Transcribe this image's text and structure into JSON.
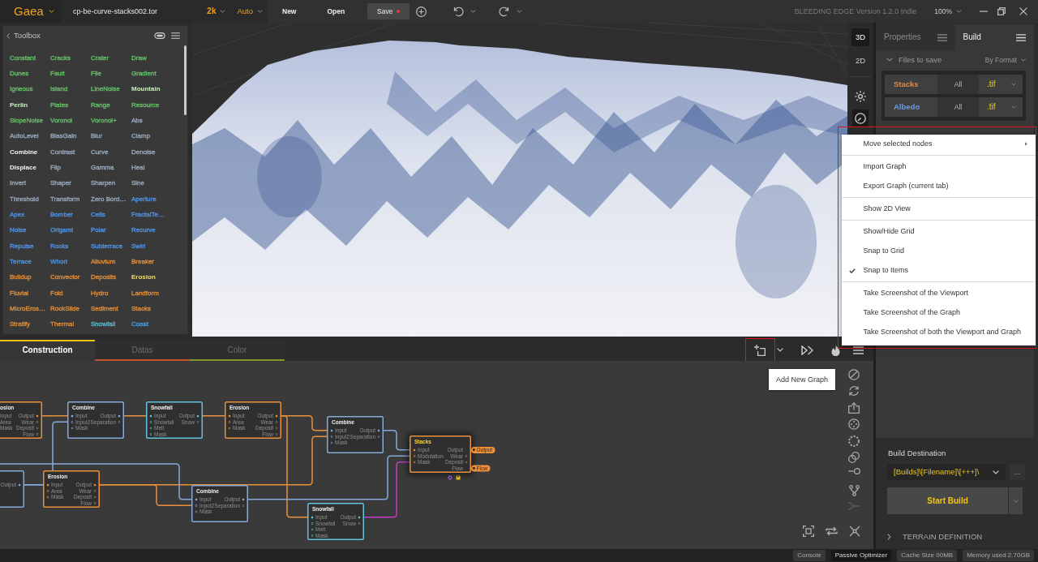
{
  "top_bar": {
    "app_name": "Gaea",
    "file_name": "cp-be-curve-stacks002.tor",
    "resolution": "2k",
    "mode": "Auto",
    "actions": [
      {
        "label": "New"
      },
      {
        "label": "Open"
      }
    ],
    "save": {
      "label": "Save",
      "unsaved": true
    },
    "version": "BLEEDING EDGE Version 1.2.0 Indie",
    "zoom": "100%"
  },
  "toolbox": {
    "title": "Toolbox",
    "items": [
      {
        "label": "Constant",
        "color": "#63b866",
        "highlighted": false
      },
      {
        "label": "Cracks",
        "color": "#63b866",
        "highlighted": false
      },
      {
        "label": "Crater",
        "color": "#63b866",
        "highlighted": false
      },
      {
        "label": "Draw",
        "color": "#63b866",
        "highlighted": false
      },
      {
        "label": "Dunes",
        "color": "#63b866",
        "highlighted": false
      },
      {
        "label": "Fault",
        "color": "#63b866",
        "highlighted": false
      },
      {
        "label": "File",
        "color": "#63b866",
        "highlighted": false
      },
      {
        "label": "Gradient",
        "color": "#63b866",
        "highlighted": false
      },
      {
        "label": "Igneous",
        "color": "#63b866",
        "highlighted": false
      },
      {
        "label": "Island",
        "color": "#63b866",
        "highlighted": false
      },
      {
        "label": "LineNoise",
        "color": "#63b866",
        "highlighted": false
      },
      {
        "label": "Mountain",
        "color": "#c9f0bd",
        "highlighted": true
      },
      {
        "label": "Perlin",
        "color": "#c9f0bd",
        "highlighted": true
      },
      {
        "label": "Plates",
        "color": "#63b866",
        "highlighted": false
      },
      {
        "label": "Range",
        "color": "#63b866",
        "highlighted": false
      },
      {
        "label": "Resource",
        "color": "#63b866",
        "highlighted": false
      },
      {
        "label": "SlopeNoise",
        "color": "#63b866",
        "highlighted": false
      },
      {
        "label": "Voronoi",
        "color": "#63b866",
        "highlighted": false
      },
      {
        "label": "Voronoi+",
        "color": "#63b866",
        "highlighted": false
      },
      {
        "label": "Abs",
        "color": "#93a4b6",
        "highlighted": false
      },
      {
        "label": "AutoLevel",
        "color": "#93a4b6",
        "highlighted": false
      },
      {
        "label": "BiasGain",
        "color": "#93a4b6",
        "highlighted": false
      },
      {
        "label": "Blur",
        "color": "#93a4b6",
        "highlighted": false
      },
      {
        "label": "Clamp",
        "color": "#93a4b6",
        "highlighted": false
      },
      {
        "label": "Combine",
        "color": "#f2f2f2",
        "highlighted": true
      },
      {
        "label": "Contrast",
        "color": "#93a4b6",
        "highlighted": false
      },
      {
        "label": "Curve",
        "color": "#93a4b6",
        "highlighted": false
      },
      {
        "label": "Denoise",
        "color": "#93a4b6",
        "highlighted": false
      },
      {
        "label": "Displace",
        "color": "#f2f2f2",
        "highlighted": true
      },
      {
        "label": "Flip",
        "color": "#93a4b6",
        "highlighted": false
      },
      {
        "label": "Gamma",
        "color": "#93a4b6",
        "highlighted": false
      },
      {
        "label": "Heal",
        "color": "#93a4b6",
        "highlighted": false
      },
      {
        "label": "Invert",
        "color": "#93a4b6",
        "highlighted": false
      },
      {
        "label": "Shaper",
        "color": "#93a4b6",
        "highlighted": false
      },
      {
        "label": "Sharpen",
        "color": "#93a4b6",
        "highlighted": false
      },
      {
        "label": "Sine",
        "color": "#93a4b6",
        "highlighted": false
      },
      {
        "label": "Threshold",
        "color": "#93a4b6",
        "highlighted": false
      },
      {
        "label": "Transform",
        "color": "#93a4b6",
        "highlighted": false
      },
      {
        "label": "Zero Bord…",
        "color": "#93a4b6",
        "highlighted": false
      },
      {
        "label": "Aperture",
        "color": "#4f8fdc",
        "highlighted": false
      },
      {
        "label": "Apex",
        "color": "#4f8fdc",
        "highlighted": false
      },
      {
        "label": "Bomber",
        "color": "#4f8fdc",
        "highlighted": false
      },
      {
        "label": "Cells",
        "color": "#4f8fdc",
        "highlighted": false
      },
      {
        "label": "FractalTe…",
        "color": "#4f8fdc",
        "highlighted": false
      },
      {
        "label": "Noise",
        "color": "#4f8fdc",
        "highlighted": false
      },
      {
        "label": "Origami",
        "color": "#4f8fdc",
        "highlighted": false
      },
      {
        "label": "Polar",
        "color": "#4f8fdc",
        "highlighted": false
      },
      {
        "label": "Recurve",
        "color": "#4f8fdc",
        "highlighted": false
      },
      {
        "label": "Repulse",
        "color": "#4f8fdc",
        "highlighted": false
      },
      {
        "label": "Rocks",
        "color": "#4f8fdc",
        "highlighted": false
      },
      {
        "label": "Subterrace",
        "color": "#4f8fdc",
        "highlighted": false
      },
      {
        "label": "Swirl",
        "color": "#4f8fdc",
        "highlighted": false
      },
      {
        "label": "Terrace",
        "color": "#4f8fdc",
        "highlighted": false
      },
      {
        "label": "Whorl",
        "color": "#4f8fdc",
        "highlighted": false
      },
      {
        "label": "Alluvium",
        "color": "#d88a3c",
        "highlighted": false
      },
      {
        "label": "Breaker",
        "color": "#d88a3c",
        "highlighted": false
      },
      {
        "label": "Buildup",
        "color": "#d88a3c",
        "highlighted": false
      },
      {
        "label": "Convector",
        "color": "#d88a3c",
        "highlighted": false
      },
      {
        "label": "Deposits",
        "color": "#d88a3c",
        "highlighted": false
      },
      {
        "label": "Erosion",
        "color": "#f3dd6a",
        "highlighted": true
      },
      {
        "label": "Fluvial",
        "color": "#d88a3c",
        "highlighted": false
      },
      {
        "label": "Fold",
        "color": "#d88a3c",
        "highlighted": false
      },
      {
        "label": "Hydro",
        "color": "#d88a3c",
        "highlighted": false
      },
      {
        "label": "Landform",
        "color": "#d88a3c",
        "highlighted": false
      },
      {
        "label": "MicroEros…",
        "color": "#d88a3c",
        "highlighted": false
      },
      {
        "label": "RockSlide",
        "color": "#d88a3c",
        "highlighted": false
      },
      {
        "label": "Sediment",
        "color": "#d88a3c",
        "highlighted": false
      },
      {
        "label": "Stacks",
        "color": "#d88a3c",
        "highlighted": false
      },
      {
        "label": "Stratify",
        "color": "#d88a3c",
        "highlighted": false
      },
      {
        "label": "Thermal",
        "color": "#d88a3c",
        "highlighted": false
      },
      {
        "label": "Snowfall",
        "color": "#55b7cb",
        "highlighted": false
      },
      {
        "label": "Coast",
        "color": "#3d9be0",
        "highlighted": false
      }
    ]
  },
  "viewport": {
    "views": [
      {
        "label": "3D",
        "selected": true
      },
      {
        "label": "2D",
        "selected": false
      }
    ],
    "tools": [
      {
        "active": false
      },
      {
        "active": true
      }
    ]
  },
  "graph": {
    "tabs": [
      {
        "label": "Construction",
        "selected": true,
        "color": "#f0c419"
      },
      {
        "label": "Datas",
        "selected": false,
        "color": "#c4532b"
      },
      {
        "label": "Color",
        "selected": false,
        "color": "#7f9a2a"
      }
    ],
    "new_graph_button": {
      "highlighted": true
    },
    "tooltip": "Add New Graph",
    "side_tools": [
      {
        "disabled": false
      },
      {
        "disabled": false
      },
      {
        "disabled": false
      },
      {
        "disabled": false
      },
      {
        "disabled": false
      },
      {
        "disabled": false
      },
      {
        "disabled": false
      },
      {
        "disabled": false
      },
      {
        "disabled": true
      }
    ],
    "nodes": [
      {
        "title": "osion",
        "color": "#e8913a",
        "selected": false,
        "inputs": [
          "Input",
          "Area",
          "Mask"
        ],
        "outputs": [
          {
            "label": "Output"
          },
          {
            "label": "Wear"
          },
          {
            "label": "Deposit"
          },
          {
            "label": "Flow"
          }
        ]
      },
      {
        "title": "Combine",
        "color": "#86a9dc",
        "selected": false,
        "inputs": [
          "Input",
          "Input2",
          "Mask"
        ],
        "outputs": [
          {
            "label": "Output"
          },
          {
            "label": "Separation"
          }
        ]
      },
      {
        "title": "Snowfall",
        "color": "#62c4dc",
        "selected": false,
        "inputs": [
          "Input",
          "Snowfall",
          "Melt",
          "Mask"
        ],
        "outputs": [
          {
            "label": "Output"
          },
          {
            "label": "Snow"
          }
        ]
      },
      {
        "title": "Erosion",
        "color": "#e8913a",
        "selected": false,
        "inputs": [
          "Input",
          "Area",
          "Mask"
        ],
        "outputs": [
          {
            "label": "Output"
          },
          {
            "label": "Wear"
          },
          {
            "label": "Deposit"
          },
          {
            "label": "Flow"
          }
        ]
      },
      {
        "title": "Combine",
        "color": "#86a9dc",
        "selected": false,
        "inputs": [
          "Input",
          "Input2",
          "Mask"
        ],
        "outputs": [
          {
            "label": "Output"
          },
          {
            "label": "Separation"
          }
        ]
      },
      {
        "title": "Stacks",
        "color": "#e8913a",
        "selected": true,
        "inputs": [
          "Input",
          "Modulation",
          "Mask"
        ],
        "outputs": [
          {
            "label": "Output",
            "tag": "Output"
          },
          {
            "label": "Wear"
          },
          {
            "label": "Deposit"
          },
          {
            "label": "Flow",
            "tag": "Flow"
          }
        ]
      },
      {
        "color": "#86a9dc",
        "selected": false,
        "outputs": [
          {
            "label": "Output"
          }
        ]
      },
      {
        "title": "Erosion",
        "color": "#e8913a",
        "selected": false,
        "inputs": [
          "Input",
          "Area",
          "Mask"
        ],
        "outputs": [
          {
            "label": "Output"
          },
          {
            "label": "Wear"
          },
          {
            "label": "Deposit"
          },
          {
            "label": "Flow"
          }
        ]
      },
      {
        "title": "Combine",
        "color": "#86a9dc",
        "selected": false,
        "inputs": [
          "Input",
          "Input2",
          "Mask"
        ],
        "outputs": [
          {
            "label": "Output"
          },
          {
            "label": "Separation"
          }
        ]
      },
      {
        "title": "Snowfall",
        "color": "#62c4dc",
        "selected": false,
        "inputs": [
          "Input",
          "Snowfall",
          "Melt",
          "Mask"
        ],
        "outputs": [
          {
            "label": "Output"
          },
          {
            "label": "Snow"
          }
        ]
      }
    ],
    "links": [
      {
        "color": "#e8913a"
      },
      {
        "color": "#e8913a"
      },
      {
        "color": "#e8913a"
      },
      {
        "color": "#e8913a"
      },
      {
        "color": "#e8913a"
      },
      {
        "color": "#e8913a"
      },
      {
        "color": "#e8913a"
      },
      {
        "color": "#86a9dc"
      },
      {
        "color": "#86a9dc"
      },
      {
        "color": "#86a9dc"
      },
      {
        "color": "#86a9dc"
      },
      {
        "color": "#86a9dc"
      },
      {
        "color": "#c23cc8"
      }
    ]
  },
  "right_panel": {
    "tabs": [
      {
        "label": "Properties",
        "selected": false
      },
      {
        "label": "Build",
        "selected": true
      }
    ],
    "files_to_save": {
      "title": "Files to save",
      "expanded": true,
      "sort": "By Format",
      "rows": [
        {
          "name": "Stacks",
          "color": "#e8873a",
          "scope": "All",
          "format": ".tif"
        },
        {
          "name": "Albedo",
          "color": "#6f9be0",
          "scope": "All",
          "format": ".tif"
        }
      ]
    },
    "build_destination": {
      "label": "Build Destination",
      "value": "[Builds]\\[Filename]\\[+++]\\",
      "browse": "..."
    },
    "start_build": "Start Build",
    "sections": [
      {
        "title": "TERRAIN DEFINITION",
        "expanded": false
      }
    ]
  },
  "context_menu": {
    "highlighted": true,
    "groups": [
      [
        {
          "label": "Move selected nodes",
          "checked": false,
          "submenu": true
        }
      ],
      [
        {
          "label": "Import Graph",
          "checked": false,
          "submenu": false
        },
        {
          "label": "Export Graph (current tab)",
          "checked": false,
          "submenu": false
        }
      ],
      [
        {
          "label": "Show 2D View",
          "checked": false,
          "submenu": false
        }
      ],
      [
        {
          "label": "Show/Hide Grid",
          "checked": false,
          "submenu": false
        },
        {
          "label": "Snap to Grid",
          "checked": false,
          "submenu": false
        },
        {
          "label": "Snap to Items",
          "checked": true,
          "submenu": false
        }
      ],
      [
        {
          "label": "Take Screenshot of the Viewport",
          "checked": false,
          "submenu": false
        },
        {
          "label": "Take Screenshot of the Graph",
          "checked": false,
          "submenu": false
        },
        {
          "label": "Take Screenshot of both the Viewport and Graph",
          "checked": false,
          "submenu": false
        }
      ]
    ]
  },
  "status_bar": {
    "items": [
      {
        "label": "Console",
        "active": false
      },
      {
        "label": "Passive Optimizer",
        "active": true
      },
      {
        "label": "Cache Size 00MB",
        "active": false
      },
      {
        "label": "Memory used 2.70GB",
        "active": false
      }
    ]
  }
}
